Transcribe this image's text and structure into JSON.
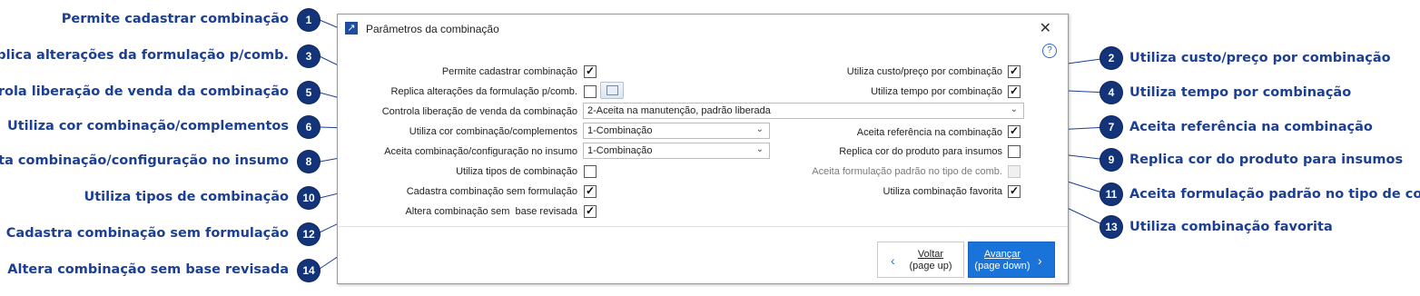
{
  "window": {
    "title": "Parâmetros da combinação",
    "close_symbol": "✕",
    "help_symbol": "?"
  },
  "fields": {
    "f1_label": "Permite cadastrar combinação",
    "f2_label": "Utiliza custo/preço por combinação",
    "f3_label": "Replica alterações da formulação p/comb.",
    "f4_label": "Utiliza tempo por combinação",
    "f5_label": "Controla liberação de venda da combinação",
    "f5_value": "2-Aceita na manutenção, padrão liberada",
    "f6_label": "Utiliza cor combinação/complementos",
    "f6_value": "1-Combinação",
    "f7_label": "Aceita referência na combinação",
    "f8_label": "Aceita combinação/configuração no insumo",
    "f8_value": "1-Combinação",
    "f9_label": "Replica cor do produto para insumos",
    "f10_label": "Utiliza tipos de combinação",
    "f11_label": "Aceita formulação padrão no tipo de comb.",
    "f12_label": "Cadastra combinação sem formulação",
    "f13_label": "Utiliza combinação favorita",
    "f14_label": "Altera combinação sem  base revisada"
  },
  "checks": {
    "f1": true,
    "f2": true,
    "f3": false,
    "f4": true,
    "f7": true,
    "f9": false,
    "f10": false,
    "f11": false,
    "f12": true,
    "f13": true,
    "f14": true
  },
  "buttons": {
    "back_line1": "Voltar",
    "back_line2": "(page up)",
    "next_line1": "Avançar",
    "next_line2": "(page down)"
  },
  "annotations": {
    "n1": {
      "num": "1",
      "text": "Permite cadastrar combinação"
    },
    "n2": {
      "num": "2",
      "text": "Utiliza custo/preço por combinação"
    },
    "n3": {
      "num": "3",
      "text": "Replica alterações da formulação p/comb."
    },
    "n4": {
      "num": "4",
      "text": "Utiliza tempo por combinação"
    },
    "n5": {
      "num": "5",
      "text": "Controla liberação de venda da combinação"
    },
    "n6": {
      "num": "6",
      "text": "Utiliza cor combinação/complementos"
    },
    "n7": {
      "num": "7",
      "text": "Aceita referência na combinação"
    },
    "n8": {
      "num": "8",
      "text": "Aceita combinação/configuração no insumo"
    },
    "n9": {
      "num": "9",
      "text": "Replica cor do produto para insumos"
    },
    "n10": {
      "num": "10",
      "text": "Utiliza tipos de combinação"
    },
    "n11": {
      "num": "11",
      "text": "Aceita formulação padrão no tipo de comb."
    },
    "n12": {
      "num": "12",
      "text": "Cadastra combinação sem formulação"
    },
    "n13": {
      "num": "13",
      "text": "Utiliza combinação favorita"
    },
    "n14": {
      "num": "14",
      "text": "Altera combinação sem base revisada"
    }
  },
  "colors": {
    "annotation_text": "#1c3f94",
    "badge": "#14347a",
    "primary_button": "#1a73d9",
    "title_icon": "#1f4e9c"
  }
}
